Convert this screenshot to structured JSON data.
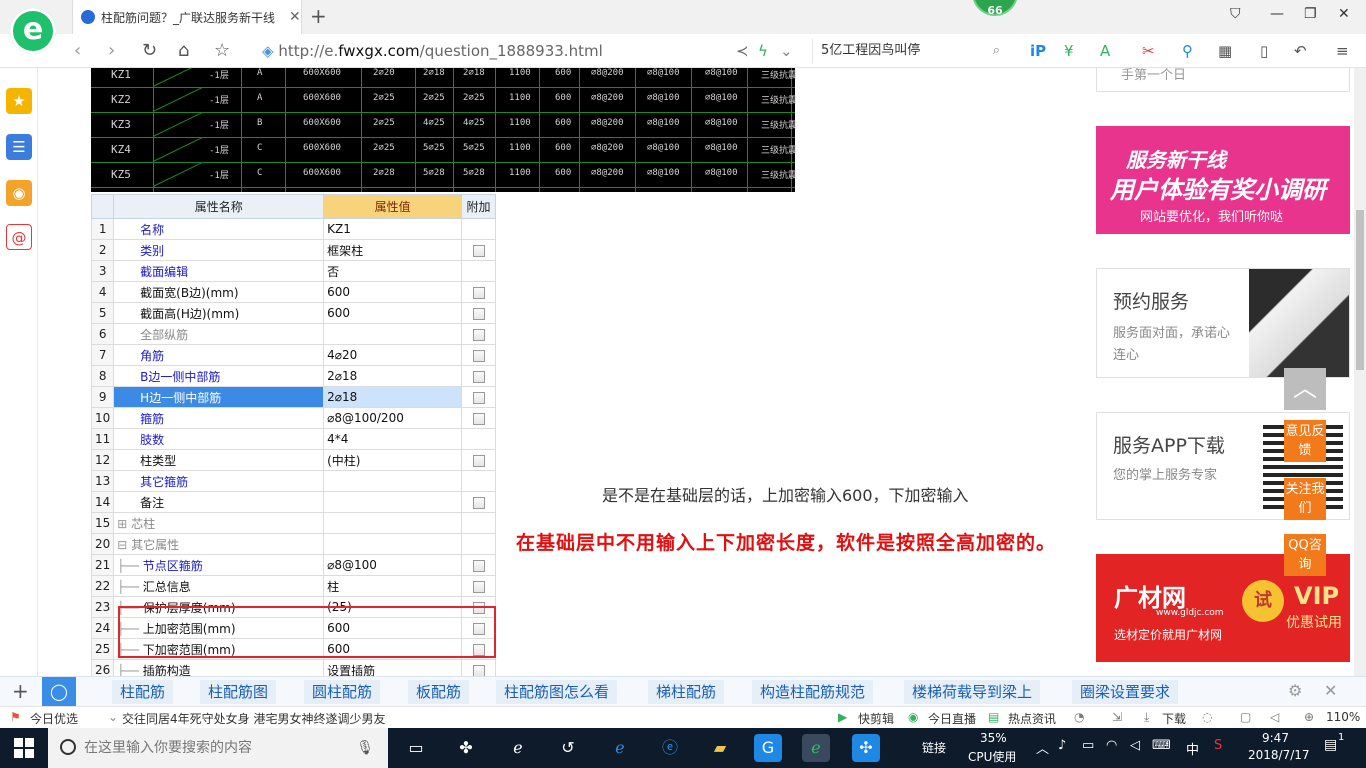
{
  "browser": {
    "tab_title": "柱配筋问题？_广联达服务新干线",
    "new_tab": "+",
    "badge": "66",
    "url_prefix": "http://e.",
    "url_host": "fwxgx.com",
    "url_path": "/question_1888933.html",
    "search_text": "5亿工程因鸟叫停"
  },
  "cad_table": {
    "rows": [
      [
        "KZ1",
        "-1层",
        "A",
        "600X600",
        "2⌀20",
        "2⌀18",
        "2⌀18",
        "1100",
        "600",
        "⌀8@200",
        "⌀8@100",
        "⌀8@100",
        "三级抗震"
      ],
      [
        "KZ2",
        "-1层",
        "A",
        "600X600",
        "2⌀25",
        "2⌀25",
        "2⌀25",
        "1100",
        "600",
        "⌀8@200",
        "⌀8@100",
        "⌀8@100",
        "三级抗震"
      ],
      [
        "KZ3",
        "-1层",
        "B",
        "600X600",
        "2⌀25",
        "4⌀25",
        "4⌀25",
        "1100",
        "600",
        "⌀8@200",
        "⌀8@100",
        "⌀8@100",
        "三级抗震"
      ],
      [
        "KZ4",
        "-1层",
        "C",
        "600X600",
        "2⌀25",
        "5⌀25",
        "5⌀25",
        "1100",
        "600",
        "⌀8@200",
        "⌀8@100",
        "⌀8@100",
        "三级抗震"
      ],
      [
        "KZ5",
        "-1层",
        "C",
        "600X600",
        "2⌀28",
        "5⌀28",
        "5⌀28",
        "1100",
        "600",
        "⌀8@200",
        "⌀8@100",
        "⌀8@100",
        "三级抗震"
      ]
    ]
  },
  "prop_table": {
    "headers": [
      "属性名称",
      "属性值",
      "附加"
    ],
    "rows": [
      {
        "n": "1",
        "name": "名称",
        "val": "KZ1",
        "style": "blue",
        "chk": false
      },
      {
        "n": "2",
        "name": "类别",
        "val": "框架柱",
        "style": "blue",
        "chk": true
      },
      {
        "n": "3",
        "name": "截面编辑",
        "val": "否",
        "style": "blue",
        "chk": false
      },
      {
        "n": "4",
        "name": "截面宽(B边)(mm)",
        "val": "600",
        "style": "dark",
        "chk": true
      },
      {
        "n": "5",
        "name": "截面高(H边)(mm)",
        "val": "600",
        "style": "dark",
        "chk": true
      },
      {
        "n": "6",
        "name": "全部纵筋",
        "val": "",
        "style": "gray",
        "chk": true
      },
      {
        "n": "7",
        "name": "角筋",
        "val": "4⌀20",
        "style": "blue",
        "chk": true
      },
      {
        "n": "8",
        "name": "B边一侧中部筋",
        "val": "2⌀18",
        "style": "blue",
        "chk": true
      },
      {
        "n": "9",
        "name": "H边一侧中部筋",
        "val": "2⌀18",
        "style": "blue",
        "chk": true,
        "selected": true
      },
      {
        "n": "10",
        "name": "箍筋",
        "val": "⌀8@100/200",
        "style": "blue",
        "chk": true
      },
      {
        "n": "11",
        "name": "肢数",
        "val": "4*4",
        "style": "blue",
        "chk": false
      },
      {
        "n": "12",
        "name": "柱类型",
        "val": "(中柱)",
        "style": "dark",
        "chk": true
      },
      {
        "n": "13",
        "name": "其它箍筋",
        "val": "",
        "style": "blue",
        "chk": false
      },
      {
        "n": "14",
        "name": "备注",
        "val": "",
        "style": "dark",
        "chk": true
      },
      {
        "n": "15",
        "name": "芯柱",
        "val": "",
        "style": "gray",
        "chk": false,
        "tree": "plus"
      },
      {
        "n": "20",
        "name": "其它属性",
        "val": "",
        "style": "gray",
        "chk": false,
        "tree": "minus"
      },
      {
        "n": "21",
        "name": "节点区箍筋",
        "val": "⌀8@100",
        "style": "blue",
        "chk": true,
        "indent": true
      },
      {
        "n": "22",
        "name": "汇总信息",
        "val": "柱",
        "style": "dark",
        "chk": true,
        "indent": true
      },
      {
        "n": "23",
        "name": "保护层厚度(mm)",
        "val": "(25)",
        "style": "dark",
        "chk": true,
        "indent": true
      },
      {
        "n": "24",
        "name": "上加密范围(mm)",
        "val": "600",
        "style": "dark",
        "chk": true,
        "indent": true
      },
      {
        "n": "25",
        "name": "下加密范围(mm)",
        "val": "600",
        "style": "dark",
        "chk": true,
        "indent": true
      },
      {
        "n": "26",
        "name": "插筋构造",
        "val": "设置插筋",
        "style": "dark",
        "chk": true,
        "indent": true
      }
    ]
  },
  "question_text": "是不是在基础层的话，上加密输入600，下加密输入",
  "answer_text": "在基础层中不用输入上下加密长度，软件是按照全高加密的。",
  "ads": {
    "survey": {
      "line1": "服务新干线",
      "line2": "用户体验有奖小调研",
      "line3": "网站要优化，我们听你哒"
    },
    "booking": {
      "title": "预约服务",
      "sub": "服务面对面，承诺心连心"
    },
    "app": {
      "title": "服务APP下载",
      "sub": "您的掌上服务专家"
    },
    "gcai": {
      "logo": "广材网",
      "url": "www.gldjc.com",
      "slogan": "选材定价就用广材网",
      "coin": "试",
      "vip": "VIP",
      "vip_sub": "优惠试用"
    },
    "top_fragment": "手第一个日"
  },
  "float_buttons": [
    "意见反馈",
    "关注我们",
    "QQ咨询"
  ],
  "related_searches": [
    "柱配筋",
    "柱配筋图",
    "圆柱配筋",
    "板配筋",
    "柱配筋图怎么看",
    "梯柱配筋",
    "构造柱配筋规范",
    "楼梯荷载导到梁上",
    "圈梁设置要求"
  ],
  "statusbar": {
    "today": "今日优选",
    "news": "交往同居4年死守处女身 港宅男女神终遂调少男友",
    "kuaijianji": "快剪辑",
    "live": "今日直播",
    "hot": "热点资讯",
    "download": "下载",
    "zoom": "110%"
  },
  "taskbar": {
    "search_placeholder": "在这里输入你要搜索的内容",
    "network": "链接",
    "cpu_pct": "35%",
    "cpu_label": "CPU使用",
    "lang": "中",
    "time": "9:47",
    "date": "2018/7/17",
    "notif_count": "1"
  }
}
